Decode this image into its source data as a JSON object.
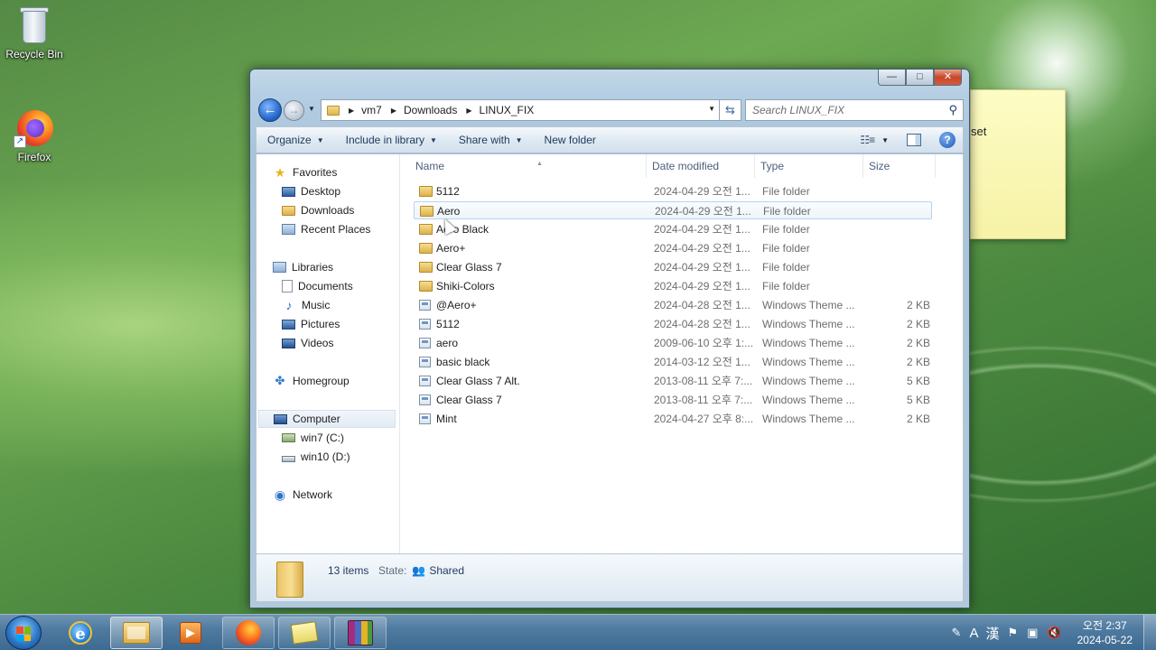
{
  "desktop": {
    "icons": [
      {
        "label": "Recycle Bin",
        "icon": "recycle-bin-icon"
      },
      {
        "label": "Firefox",
        "icon": "firefox-icon"
      }
    ],
    "sticky_note_text": "set"
  },
  "window": {
    "caption_buttons": {
      "minimize": "—",
      "maximize": "□",
      "close": "✕"
    },
    "address": {
      "crumbs": [
        "vm7",
        "Downloads",
        "LINUX_FIX"
      ]
    },
    "search": {
      "placeholder": "Search LINUX_FIX"
    },
    "toolbar": {
      "organize": "Organize",
      "include_in_library": "Include in library",
      "share_with": "Share with",
      "new_folder": "New folder"
    },
    "nav": {
      "favorites": "Favorites",
      "desktop": "Desktop",
      "downloads": "Downloads",
      "recent_places": "Recent Places",
      "libraries": "Libraries",
      "documents": "Documents",
      "music": "Music",
      "pictures": "Pictures",
      "videos": "Videos",
      "homegroup": "Homegroup",
      "computer": "Computer",
      "drive_c": "win7 (C:)",
      "drive_d": "win10 (D:)",
      "network": "Network"
    },
    "columns": {
      "name": "Name",
      "date_modified": "Date modified",
      "type": "Type",
      "size": "Size"
    },
    "files": [
      {
        "name": "5112",
        "date": "2024-04-29 오전 1...",
        "type": "File folder",
        "size": "",
        "kind": "folder"
      },
      {
        "name": "Aero",
        "date": "2024-04-29 오전 1...",
        "type": "File folder",
        "size": "",
        "kind": "folder"
      },
      {
        "name": "Aero Black",
        "date": "2024-04-29 오전 1...",
        "type": "File folder",
        "size": "",
        "kind": "folder"
      },
      {
        "name": "Aero+",
        "date": "2024-04-29 오전 1...",
        "type": "File folder",
        "size": "",
        "kind": "folder"
      },
      {
        "name": "Clear Glass 7",
        "date": "2024-04-29 오전 1...",
        "type": "File folder",
        "size": "",
        "kind": "folder"
      },
      {
        "name": "Shiki-Colors",
        "date": "2024-04-29 오전 1...",
        "type": "File folder",
        "size": "",
        "kind": "folder"
      },
      {
        "name": "@Aero+",
        "date": "2024-04-28 오전 1...",
        "type": "Windows Theme ...",
        "size": "2 KB",
        "kind": "theme"
      },
      {
        "name": "5112",
        "date": "2024-04-28 오전 1...",
        "type": "Windows Theme ...",
        "size": "2 KB",
        "kind": "theme"
      },
      {
        "name": "aero",
        "date": "2009-06-10 오후 1:...",
        "type": "Windows Theme ...",
        "size": "2 KB",
        "kind": "theme"
      },
      {
        "name": "basic black",
        "date": "2014-03-12 오전 1...",
        "type": "Windows Theme ...",
        "size": "2 KB",
        "kind": "theme"
      },
      {
        "name": "Clear Glass 7 Alt.",
        "date": "2013-08-11 오후 7:...",
        "type": "Windows Theme ...",
        "size": "5 KB",
        "kind": "theme"
      },
      {
        "name": "Clear Glass 7",
        "date": "2013-08-11 오후 7:...",
        "type": "Windows Theme ...",
        "size": "5 KB",
        "kind": "theme"
      },
      {
        "name": "Mint",
        "date": "2024-04-27 오후 8:...",
        "type": "Windows Theme ...",
        "size": "2 KB",
        "kind": "theme"
      }
    ],
    "hover_row_index": 1,
    "details": {
      "count": "13 items",
      "state_label": "State:",
      "state_value": "Shared"
    }
  },
  "taskbar": {
    "apps": [
      "internet-explorer",
      "windows-explorer",
      "media-player",
      "firefox",
      "file-manager",
      "winrar"
    ],
    "tray": {
      "ime_a": "A",
      "ime_han": "漢"
    },
    "clock": {
      "time": "오전 2:37",
      "date": "2024-05-22"
    }
  }
}
